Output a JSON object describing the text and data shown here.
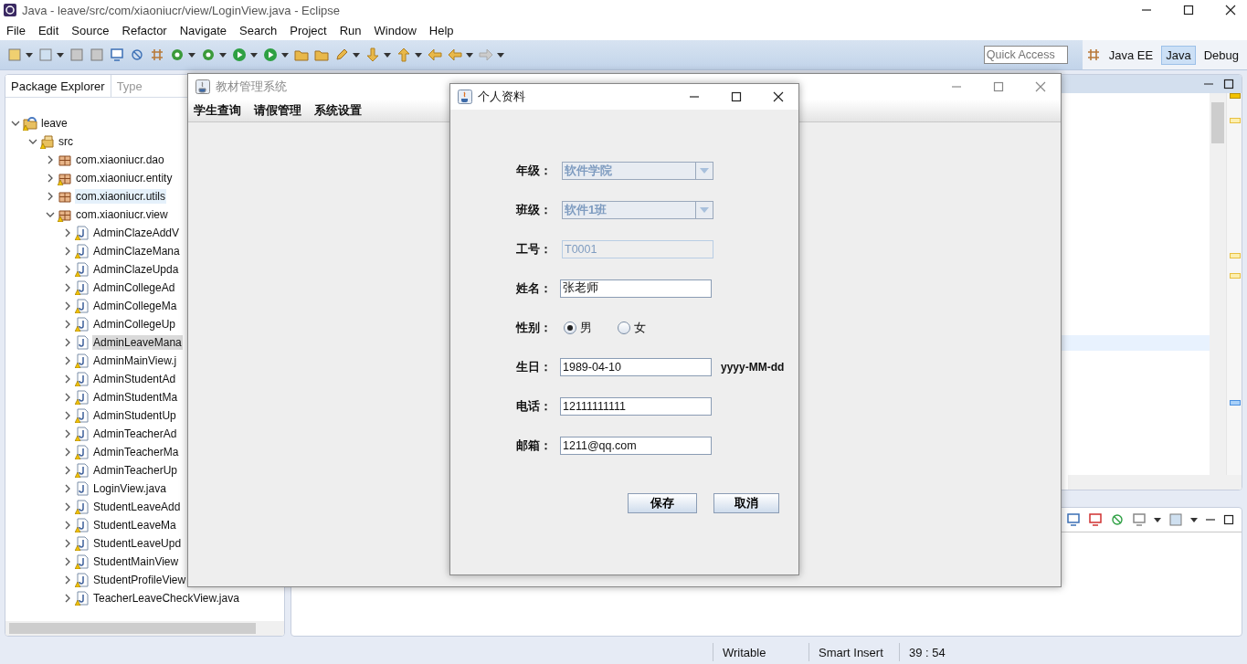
{
  "window": {
    "title": "Java - leave/src/com/xiaoniucr/view/LoginView.java - Eclipse"
  },
  "menu": [
    "File",
    "Edit",
    "Source",
    "Refactor",
    "Navigate",
    "Search",
    "Project",
    "Run",
    "Window",
    "Help"
  ],
  "quick_access": {
    "placeholder": "Quick Access"
  },
  "perspectives": [
    {
      "label": "Java EE",
      "selected": false
    },
    {
      "label": "Java",
      "selected": true
    },
    {
      "label": "Debug",
      "selected": false
    }
  ],
  "package_explorer": {
    "tabs": [
      {
        "label": "Package Explorer",
        "selected": true
      },
      {
        "label": "Type",
        "selected": false
      }
    ],
    "tree": [
      {
        "label": "leave",
        "kind": "project",
        "expanded": true,
        "selected": false,
        "hovered": false,
        "warning": true,
        "children": [
          {
            "label": "src",
            "kind": "folder",
            "expanded": true,
            "selected": false,
            "hovered": false,
            "warning": true,
            "children": [
              {
                "label": "com.xiaoniucr.dao",
                "kind": "package",
                "expanded": false,
                "selected": false,
                "hovered": false,
                "warning": false
              },
              {
                "label": "com.xiaoniucr.entity",
                "kind": "package",
                "expanded": false,
                "selected": false,
                "hovered": false,
                "warning": true
              },
              {
                "label": "com.xiaoniucr.utils",
                "kind": "package",
                "expanded": false,
                "selected": false,
                "hovered": true,
                "warning": false
              },
              {
                "label": "com.xiaoniucr.view",
                "kind": "package",
                "expanded": true,
                "selected": false,
                "hovered": false,
                "warning": true,
                "children": [
                  {
                    "label": "AdminClazeAddV",
                    "kind": "java",
                    "expanded": false,
                    "selected": false,
                    "hovered": false,
                    "warning": true
                  },
                  {
                    "label": "AdminClazeMana",
                    "kind": "java",
                    "expanded": false,
                    "selected": false,
                    "hovered": false,
                    "warning": true
                  },
                  {
                    "label": "AdminClazeUpda",
                    "kind": "java",
                    "expanded": false,
                    "selected": false,
                    "hovered": false,
                    "warning": true
                  },
                  {
                    "label": "AdminCollegeAd",
                    "kind": "java",
                    "expanded": false,
                    "selected": false,
                    "hovered": false,
                    "warning": true
                  },
                  {
                    "label": "AdminCollegeMa",
                    "kind": "java",
                    "expanded": false,
                    "selected": false,
                    "hovered": false,
                    "warning": true
                  },
                  {
                    "label": "AdminCollegeUp",
                    "kind": "java",
                    "expanded": false,
                    "selected": false,
                    "hovered": false,
                    "warning": true
                  },
                  {
                    "label": "AdminLeaveMana",
                    "kind": "java",
                    "expanded": false,
                    "selected": true,
                    "hovered": false,
                    "warning": false
                  },
                  {
                    "label": "AdminMainView.j",
                    "kind": "java",
                    "expanded": false,
                    "selected": false,
                    "hovered": false,
                    "warning": true
                  },
                  {
                    "label": "AdminStudentAd",
                    "kind": "java",
                    "expanded": false,
                    "selected": false,
                    "hovered": false,
                    "warning": true
                  },
                  {
                    "label": "AdminStudentMa",
                    "kind": "java",
                    "expanded": false,
                    "selected": false,
                    "hovered": false,
                    "warning": true
                  },
                  {
                    "label": "AdminStudentUp",
                    "kind": "java",
                    "expanded": false,
                    "selected": false,
                    "hovered": false,
                    "warning": true
                  },
                  {
                    "label": "AdminTeacherAd",
                    "kind": "java",
                    "expanded": false,
                    "selected": false,
                    "hovered": false,
                    "warning": true
                  },
                  {
                    "label": "AdminTeacherMa",
                    "kind": "java",
                    "expanded": false,
                    "selected": false,
                    "hovered": false,
                    "warning": true
                  },
                  {
                    "label": "AdminTeacherUp",
                    "kind": "java",
                    "expanded": false,
                    "selected": false,
                    "hovered": false,
                    "warning": true
                  },
                  {
                    "label": "LoginView.java",
                    "kind": "java",
                    "expanded": false,
                    "selected": false,
                    "hovered": false,
                    "warning": false
                  },
                  {
                    "label": "StudentLeaveAdd",
                    "kind": "java",
                    "expanded": false,
                    "selected": false,
                    "hovered": false,
                    "warning": true
                  },
                  {
                    "label": "StudentLeaveMa",
                    "kind": "java",
                    "expanded": false,
                    "selected": false,
                    "hovered": false,
                    "warning": true
                  },
                  {
                    "label": "StudentLeaveUpd",
                    "kind": "java",
                    "expanded": false,
                    "selected": false,
                    "hovered": false,
                    "warning": true
                  },
                  {
                    "label": "StudentMainView",
                    "kind": "java",
                    "expanded": false,
                    "selected": false,
                    "hovered": false,
                    "warning": true
                  },
                  {
                    "label": "StudentProfileView",
                    "kind": "java",
                    "expanded": false,
                    "selected": false,
                    "hovered": false,
                    "warning": true
                  },
                  {
                    "label": "TeacherLeaveCheckView.java",
                    "kind": "java",
                    "expanded": false,
                    "selected": false,
                    "hovered": false,
                    "warning": true
                  }
                ]
              }
            ]
          }
        ]
      }
    ]
  },
  "status_bar": [
    "Writable",
    "Smart Insert",
    "39 : 54"
  ],
  "app_window": {
    "title": "教材管理系统",
    "menu": [
      "学生查询",
      "请假管理",
      "系统设置"
    ]
  },
  "dialog": {
    "title": "个人资料",
    "fields": [
      {
        "kind": "combo",
        "label": "年级：",
        "value": "软件学院",
        "disabled": true
      },
      {
        "kind": "combo",
        "label": "班级：",
        "value": "软件1班",
        "disabled": true
      },
      {
        "kind": "text",
        "label": "工号：",
        "value": "T0001",
        "disabled": true
      },
      {
        "kind": "text",
        "label": "姓名：",
        "value": "张老师",
        "disabled": false
      },
      {
        "kind": "radio",
        "label": "性别：",
        "options": [
          {
            "label": "男",
            "selected": true
          },
          {
            "label": "女",
            "selected": false
          }
        ]
      },
      {
        "kind": "text",
        "label": "生日：",
        "value": "1989-04-10",
        "disabled": false,
        "hint": "yyyy-MM-dd"
      },
      {
        "kind": "text",
        "label": "电话：",
        "value": "12111111111",
        "disabled": false
      },
      {
        "kind": "text",
        "label": "邮箱：",
        "value": "1211@qq.com",
        "disabled": false
      }
    ],
    "buttons": [
      "保存",
      "取消"
    ]
  }
}
